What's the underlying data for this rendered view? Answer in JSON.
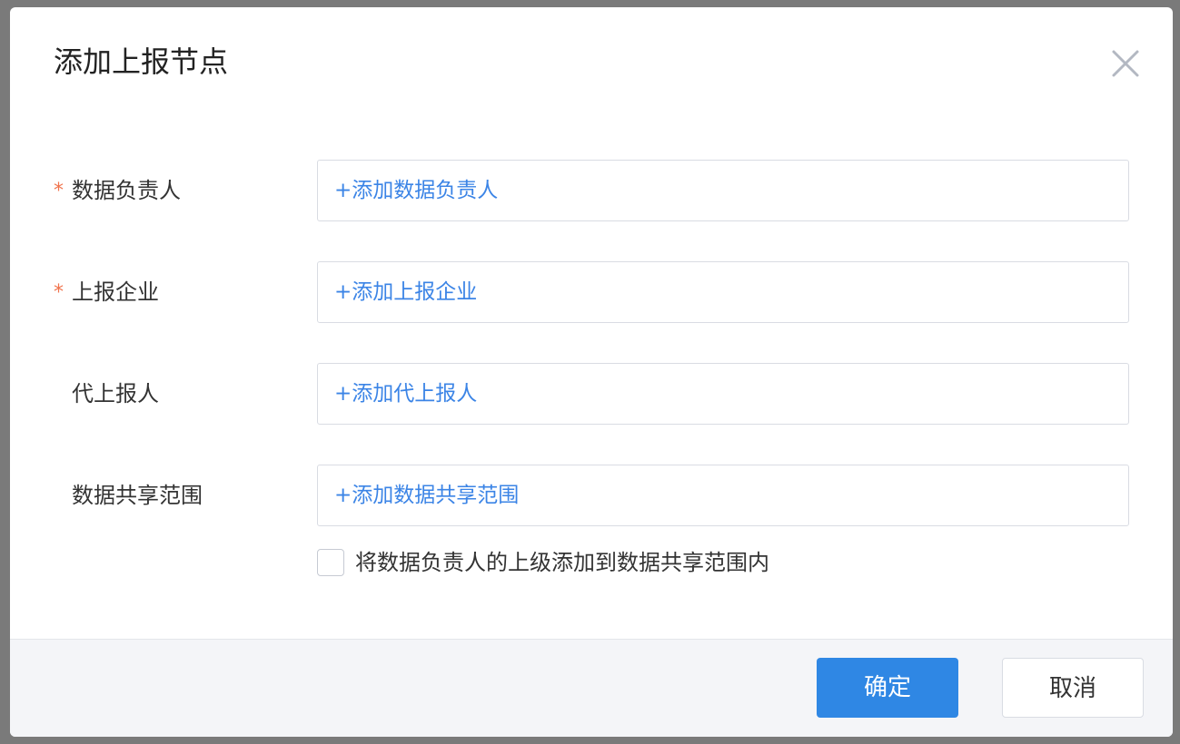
{
  "dialog": {
    "title": "添加上报节点",
    "close_icon": "close-icon"
  },
  "form": {
    "required_mark": "*",
    "rows": [
      {
        "label": "数据负责人",
        "required": true,
        "add_text": "+添加数据负责人"
      },
      {
        "label": "上报企业",
        "required": true,
        "add_text": "+添加上报企业"
      },
      {
        "label": "代上报人",
        "required": false,
        "add_text": "+添加代上报人"
      },
      {
        "label": "数据共享范围",
        "required": false,
        "add_text": "+添加数据共享范围"
      }
    ],
    "checkbox": {
      "label": "将数据负责人的上级添加到数据共享范围内",
      "checked": false
    }
  },
  "footer": {
    "confirm_label": "确定",
    "cancel_label": "取消"
  },
  "colors": {
    "accent": "#2f87e4",
    "link": "#3b84e6",
    "required": "#f0734c",
    "footer_bg": "#f4f5f8"
  }
}
